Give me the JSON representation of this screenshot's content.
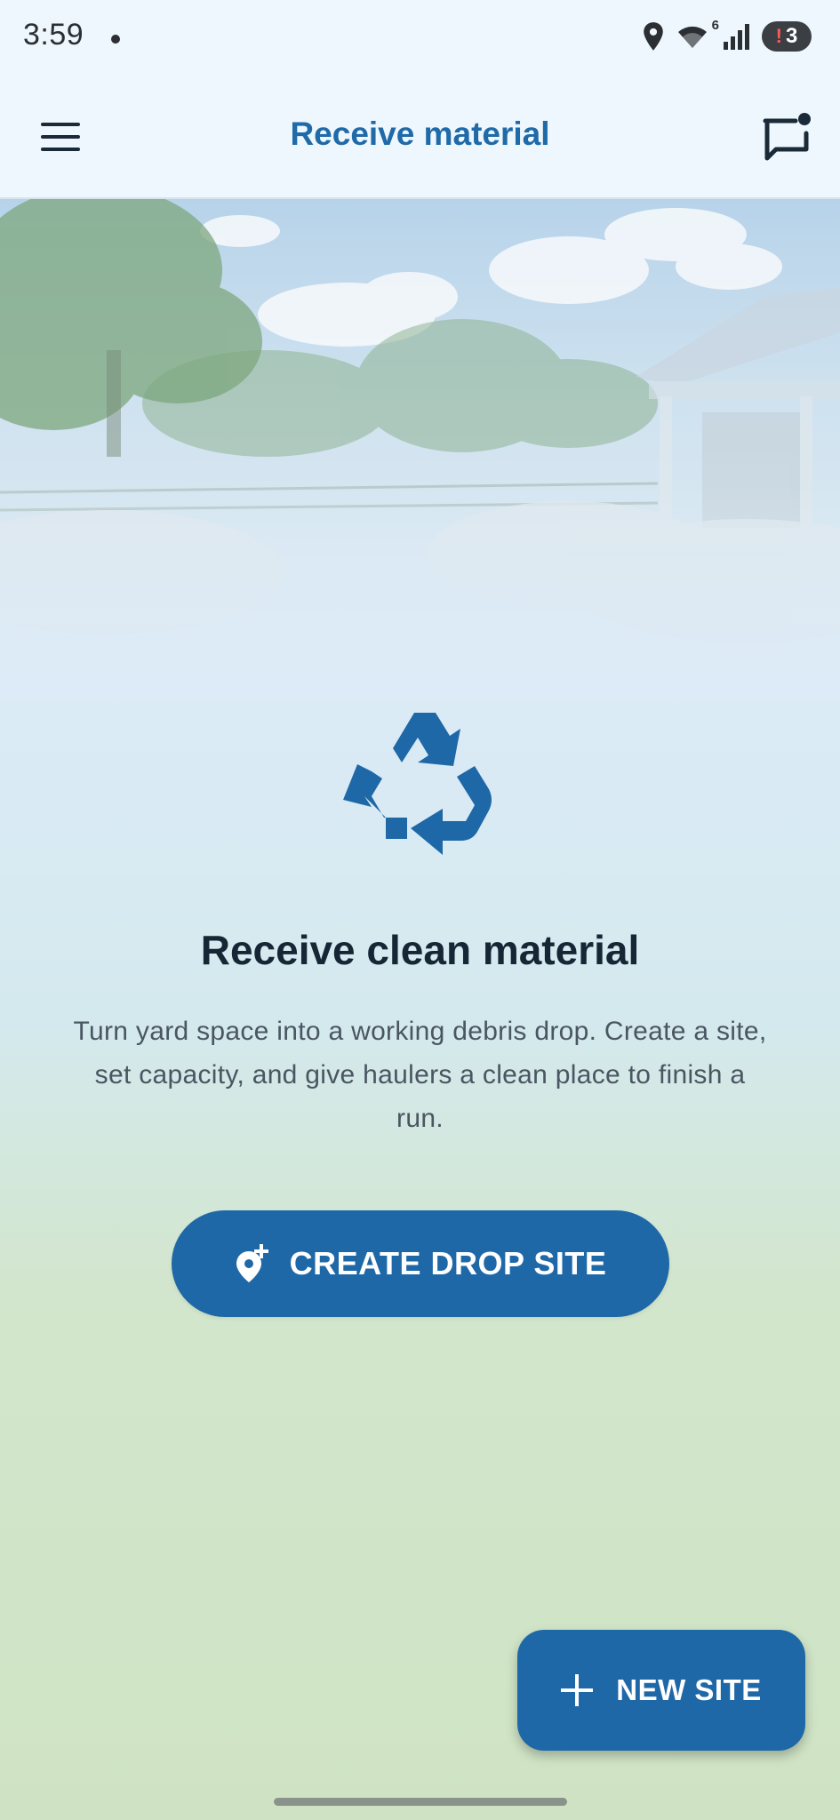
{
  "status_bar": {
    "time": "3:59",
    "battery_level": "3",
    "battery_alert": "!",
    "wifi_badge": "6"
  },
  "app_bar": {
    "title": "Receive material"
  },
  "empty_state": {
    "headline": "Receive clean material",
    "description": "Turn yard space into a working debris drop. Create a site, set capacity, and give haulers a clean place to finish a run.",
    "create_button_label": "CREATE DROP SITE"
  },
  "fab": {
    "label": "NEW SITE"
  },
  "colors": {
    "primary": "#1f68a8",
    "title_blue": "#1f6aa8",
    "heading": "#162635",
    "body_text": "#4a5662"
  },
  "icons": {
    "menu": "hamburger-menu-icon",
    "chat": "chat-notification-icon",
    "recycle": "recycle-icon",
    "add_location": "add-location-icon",
    "plus": "plus-icon"
  }
}
